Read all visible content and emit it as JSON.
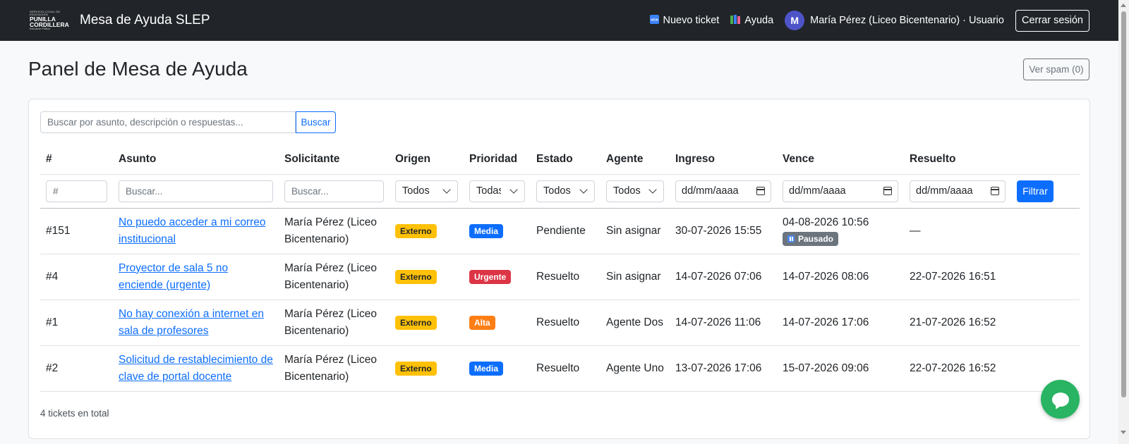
{
  "navbar": {
    "logo_lines": [
      "SERVICIO LOCAL DE EDUCACIÓN",
      "PUNILLA",
      "CORDILLERA",
      "Educación Pública"
    ],
    "title": "Mesa de Ayuda SLEP",
    "new_ticket_label": "Nuevo ticket",
    "new_ticket_icon": "new-badge-icon",
    "help_label": "Ayuda",
    "help_icon": "books-icon",
    "avatar_initial": "M",
    "user_label": "María Pérez (Liceo Bicentenario) · Usuario",
    "logout_label": "Cerrar sesión"
  },
  "header": {
    "title": "Panel de Mesa de Ayuda",
    "spam_label": "Ver spam (0)"
  },
  "search": {
    "placeholder": "Buscar por asunto, descripción o respuestas...",
    "button_label": "Buscar"
  },
  "table": {
    "columns": [
      "#",
      "Asunto",
      "Solicitante",
      "Origen",
      "Prioridad",
      "Estado",
      "Agente",
      "Ingreso",
      "Vence",
      "Resuelto"
    ],
    "filters": {
      "id_placeholder": "#",
      "subject_placeholder": "Buscar...",
      "requester_placeholder": "Buscar...",
      "origin_value": "Todos",
      "priority_value": "Todas",
      "status_value": "Todos",
      "agent_value": "Todos",
      "date_placeholder": "dd/mm/aaaa",
      "filter_button": "Filtrar"
    },
    "rows": [
      {
        "id": "#151",
        "subject": "No puedo acceder a mi correo institucional",
        "requester": "María Pérez (Liceo Bicentenario)",
        "origin": "Externo",
        "priority": "Media",
        "status": "Pendiente",
        "agent": "Sin asignar",
        "created": "30-07-2026 15:55",
        "due": "04-08-2026 10:56",
        "due_badge": "Pausado",
        "resolved": "—"
      },
      {
        "id": "#4",
        "subject": "Proyector de sala 5 no enciende (urgente)",
        "requester": "María Pérez (Liceo Bicentenario)",
        "origin": "Externo",
        "priority": "Urgente",
        "status": "Resuelto",
        "agent": "Sin asignar",
        "created": "14-07-2026 07:06",
        "due": "14-07-2026 08:06",
        "resolved": "22-07-2026 16:51"
      },
      {
        "id": "#1",
        "subject": "No hay conexión a internet en sala de profesores",
        "requester": "María Pérez (Liceo Bicentenario)",
        "origin": "Externo",
        "priority": "Alta",
        "status": "Resuelto",
        "agent": "Agente Dos",
        "created": "14-07-2026 11:06",
        "due": "14-07-2026 17:06",
        "resolved": "21-07-2026 16:52"
      },
      {
        "id": "#2",
        "subject": "Solicitud de restablecimiento de clave de portal docente",
        "requester": "María Pérez (Liceo Bicentenario)",
        "origin": "Externo",
        "priority": "Media",
        "status": "Resuelto",
        "agent": "Agente Uno",
        "created": "13-07-2026 17:06",
        "due": "15-07-2026 09:06",
        "resolved": "22-07-2026 16:52"
      }
    ]
  },
  "footer": {
    "count_label": "4 tickets en total"
  },
  "chat": {
    "icon": "chat-bubble-icon"
  },
  "colors": {
    "navbar": "#212529",
    "primary": "#0d6efd",
    "warning": "#ffc107",
    "danger": "#dc3545",
    "orange": "#fd7e14",
    "secondary": "#6c757d",
    "chat": "#28b463"
  }
}
